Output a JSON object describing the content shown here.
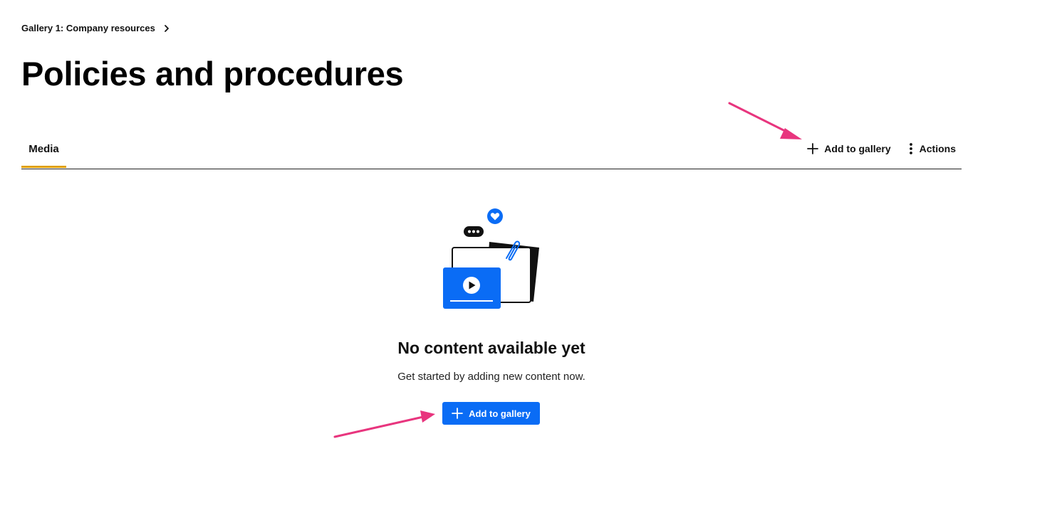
{
  "breadcrumb": {
    "label": "Gallery 1: Company resources",
    "chevron_icon": "chevron-right-icon"
  },
  "page": {
    "title": "Policies and procedures"
  },
  "tabs": [
    {
      "label": "Media",
      "selected": true
    }
  ],
  "toolbar": {
    "add_label": "Add to gallery",
    "add_icon": "plus-icon",
    "actions_label": "Actions",
    "actions_icon": "vertical-ellipsis-icon"
  },
  "empty_state": {
    "illustration": "media-folder-illustration",
    "title": "No content available yet",
    "subtitle": "Get started by adding new content now.",
    "button_label": "Add to gallery",
    "button_icon": "plus-icon"
  },
  "colors": {
    "accent_blue": "#0a6cf5",
    "tab_underline": "#e0a000",
    "annotation_arrow": "#e8357e"
  }
}
